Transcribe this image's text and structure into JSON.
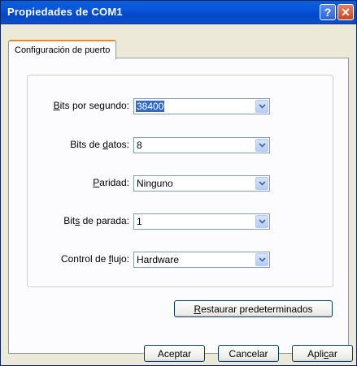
{
  "window": {
    "title": "Propiedades de COM1",
    "help_symbol": "?",
    "close_symbol": "✕"
  },
  "tab": {
    "label": "Configuración de puerto"
  },
  "fields": [
    {
      "label_pre": "",
      "label_u": "B",
      "label_post": "its por segundo:",
      "value": "38400",
      "selected": true
    },
    {
      "label_pre": "Bits de ",
      "label_u": "d",
      "label_post": "atos:",
      "value": "8",
      "selected": false
    },
    {
      "label_pre": "",
      "label_u": "P",
      "label_post": "aridad:",
      "value": "Ninguno",
      "selected": false
    },
    {
      "label_pre": "Bit",
      "label_u": "s",
      "label_post": " de parada:",
      "value": "1",
      "selected": false
    },
    {
      "label_pre": "Control de ",
      "label_u": "f",
      "label_post": "lujo:",
      "value": "Hardware",
      "selected": false
    }
  ],
  "restore": {
    "pre": "",
    "u": "R",
    "post": "estaurar predeterminados"
  },
  "buttons": {
    "accept": "Aceptar",
    "cancel": "Cancelar",
    "apply_pre": "Apli",
    "apply_u": "c",
    "apply_post": "ar"
  },
  "icons": {
    "dropdown": "chevron-down-icon",
    "help": "help-icon",
    "close": "close-icon"
  }
}
